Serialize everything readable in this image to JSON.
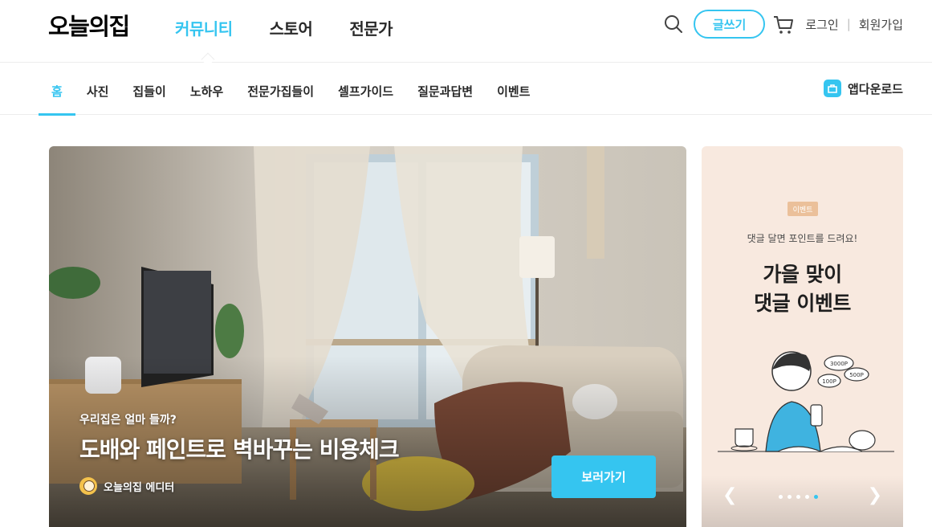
{
  "brand": {
    "logo": "오늘의집",
    "accent_color": "#35c5f0"
  },
  "main_nav": {
    "items": [
      {
        "label": "커뮤니티",
        "active": true
      },
      {
        "label": "스토어",
        "active": false
      },
      {
        "label": "전문가",
        "active": false
      }
    ]
  },
  "toolbar": {
    "search_icon": "search-icon",
    "write_label": "글쓰기",
    "cart_icon": "cart-icon",
    "login_label": "로그인",
    "signup_label": "회원가입"
  },
  "sub_nav": {
    "items": [
      {
        "label": "홈",
        "active": true
      },
      {
        "label": "사진",
        "active": false
      },
      {
        "label": "집들이",
        "active": false
      },
      {
        "label": "노하우",
        "active": false
      },
      {
        "label": "전문가집들이",
        "active": false
      },
      {
        "label": "셀프가이드",
        "active": false
      },
      {
        "label": "질문과답변",
        "active": false
      },
      {
        "label": "이벤트",
        "active": false
      }
    ],
    "app_download_label": "앱다운로드"
  },
  "hero": {
    "subtitle": "우리집은 얼마 들까?",
    "title": "도배와 페인트로 벽바꾸는 비용체크",
    "author": "오늘의집 에디터",
    "cta_label": "보러가기"
  },
  "side_banner": {
    "badge": "이벤트",
    "subtitle": "댓글 달면 포인트를 드려요!",
    "title_line1": "가을 맞이",
    "title_line2": "댓글 이벤트",
    "illustration_labels": [
      "3000P",
      "500P",
      "100P"
    ],
    "carousel": {
      "total": 5,
      "current": 5
    }
  }
}
